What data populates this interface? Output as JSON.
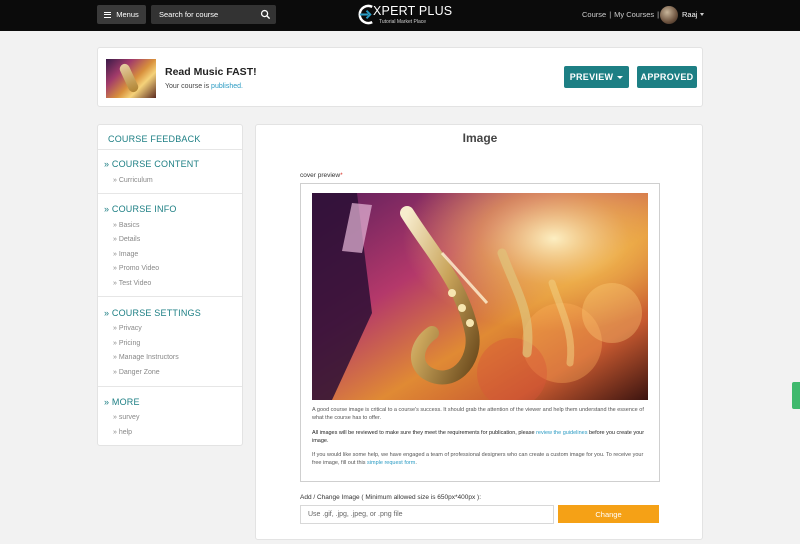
{
  "topbar": {
    "menus_label": "Menus",
    "search_placeholder": "Search for course",
    "logo_title": "XPERT PLUS",
    "logo_subtitle": "Tutorial Market Place",
    "link_course": "Course",
    "link_my_courses": "My Courses",
    "separator": "|",
    "user_name": "Raaj"
  },
  "course": {
    "title": "Read Music FAST!",
    "status_prefix": "Your course is ",
    "status_value": "published.",
    "preview_label": "PREVIEW",
    "approved_label": "APPROVED"
  },
  "sidebar": {
    "feedback": "COURSE FEEDBACK",
    "sections": [
      {
        "title": "» COURSE CONTENT",
        "items": [
          "» Curriculum"
        ]
      },
      {
        "title": "» COURSE INFO",
        "items": [
          "» Basics",
          "» Details",
          "» Image",
          "» Promo Video",
          "» Test Video"
        ]
      },
      {
        "title": "» COURSE SETTINGS",
        "items": [
          "» Privacy",
          "» Pricing",
          "» Manage Instructors",
          "» Danger Zone"
        ]
      },
      {
        "title": "» MORE",
        "items": [
          "» survey",
          "» help"
        ]
      }
    ]
  },
  "main": {
    "title": "Image",
    "cover_label": "cover preview",
    "required_mark": "*",
    "note1": "A good course image is critical to a course's success. It should grab the attention of the viewer and help them understand the essence of what the course has to offer.",
    "note2_pre": "All images will be reviewed to make sure they meet the requirements for publication, please ",
    "note2_link": "review the guidelines",
    "note2_post": " before you create your image.",
    "note3_pre": "If you would like some help, we have engaged a team of professional designers who can create a custom image for you. To receive your free image, fill out this ",
    "note3_link": "simple request form",
    "note3_post": ".",
    "add_label": "Add / Change Image ( Minimum allowed size is 650px*400px ):",
    "file_placeholder": "Use .gif, .jpg, .jpeg, or .png file",
    "change_label": "Change"
  },
  "colors": {
    "accent": "#1d7f84",
    "link": "#2a9bc3",
    "orange": "#f5a116",
    "topbar": "#0b0b0b"
  },
  "icons": [
    "menu-icon",
    "search-icon",
    "expert-plus-logo-icon",
    "chevron-down-icon",
    "feedback-tab-icon"
  ]
}
